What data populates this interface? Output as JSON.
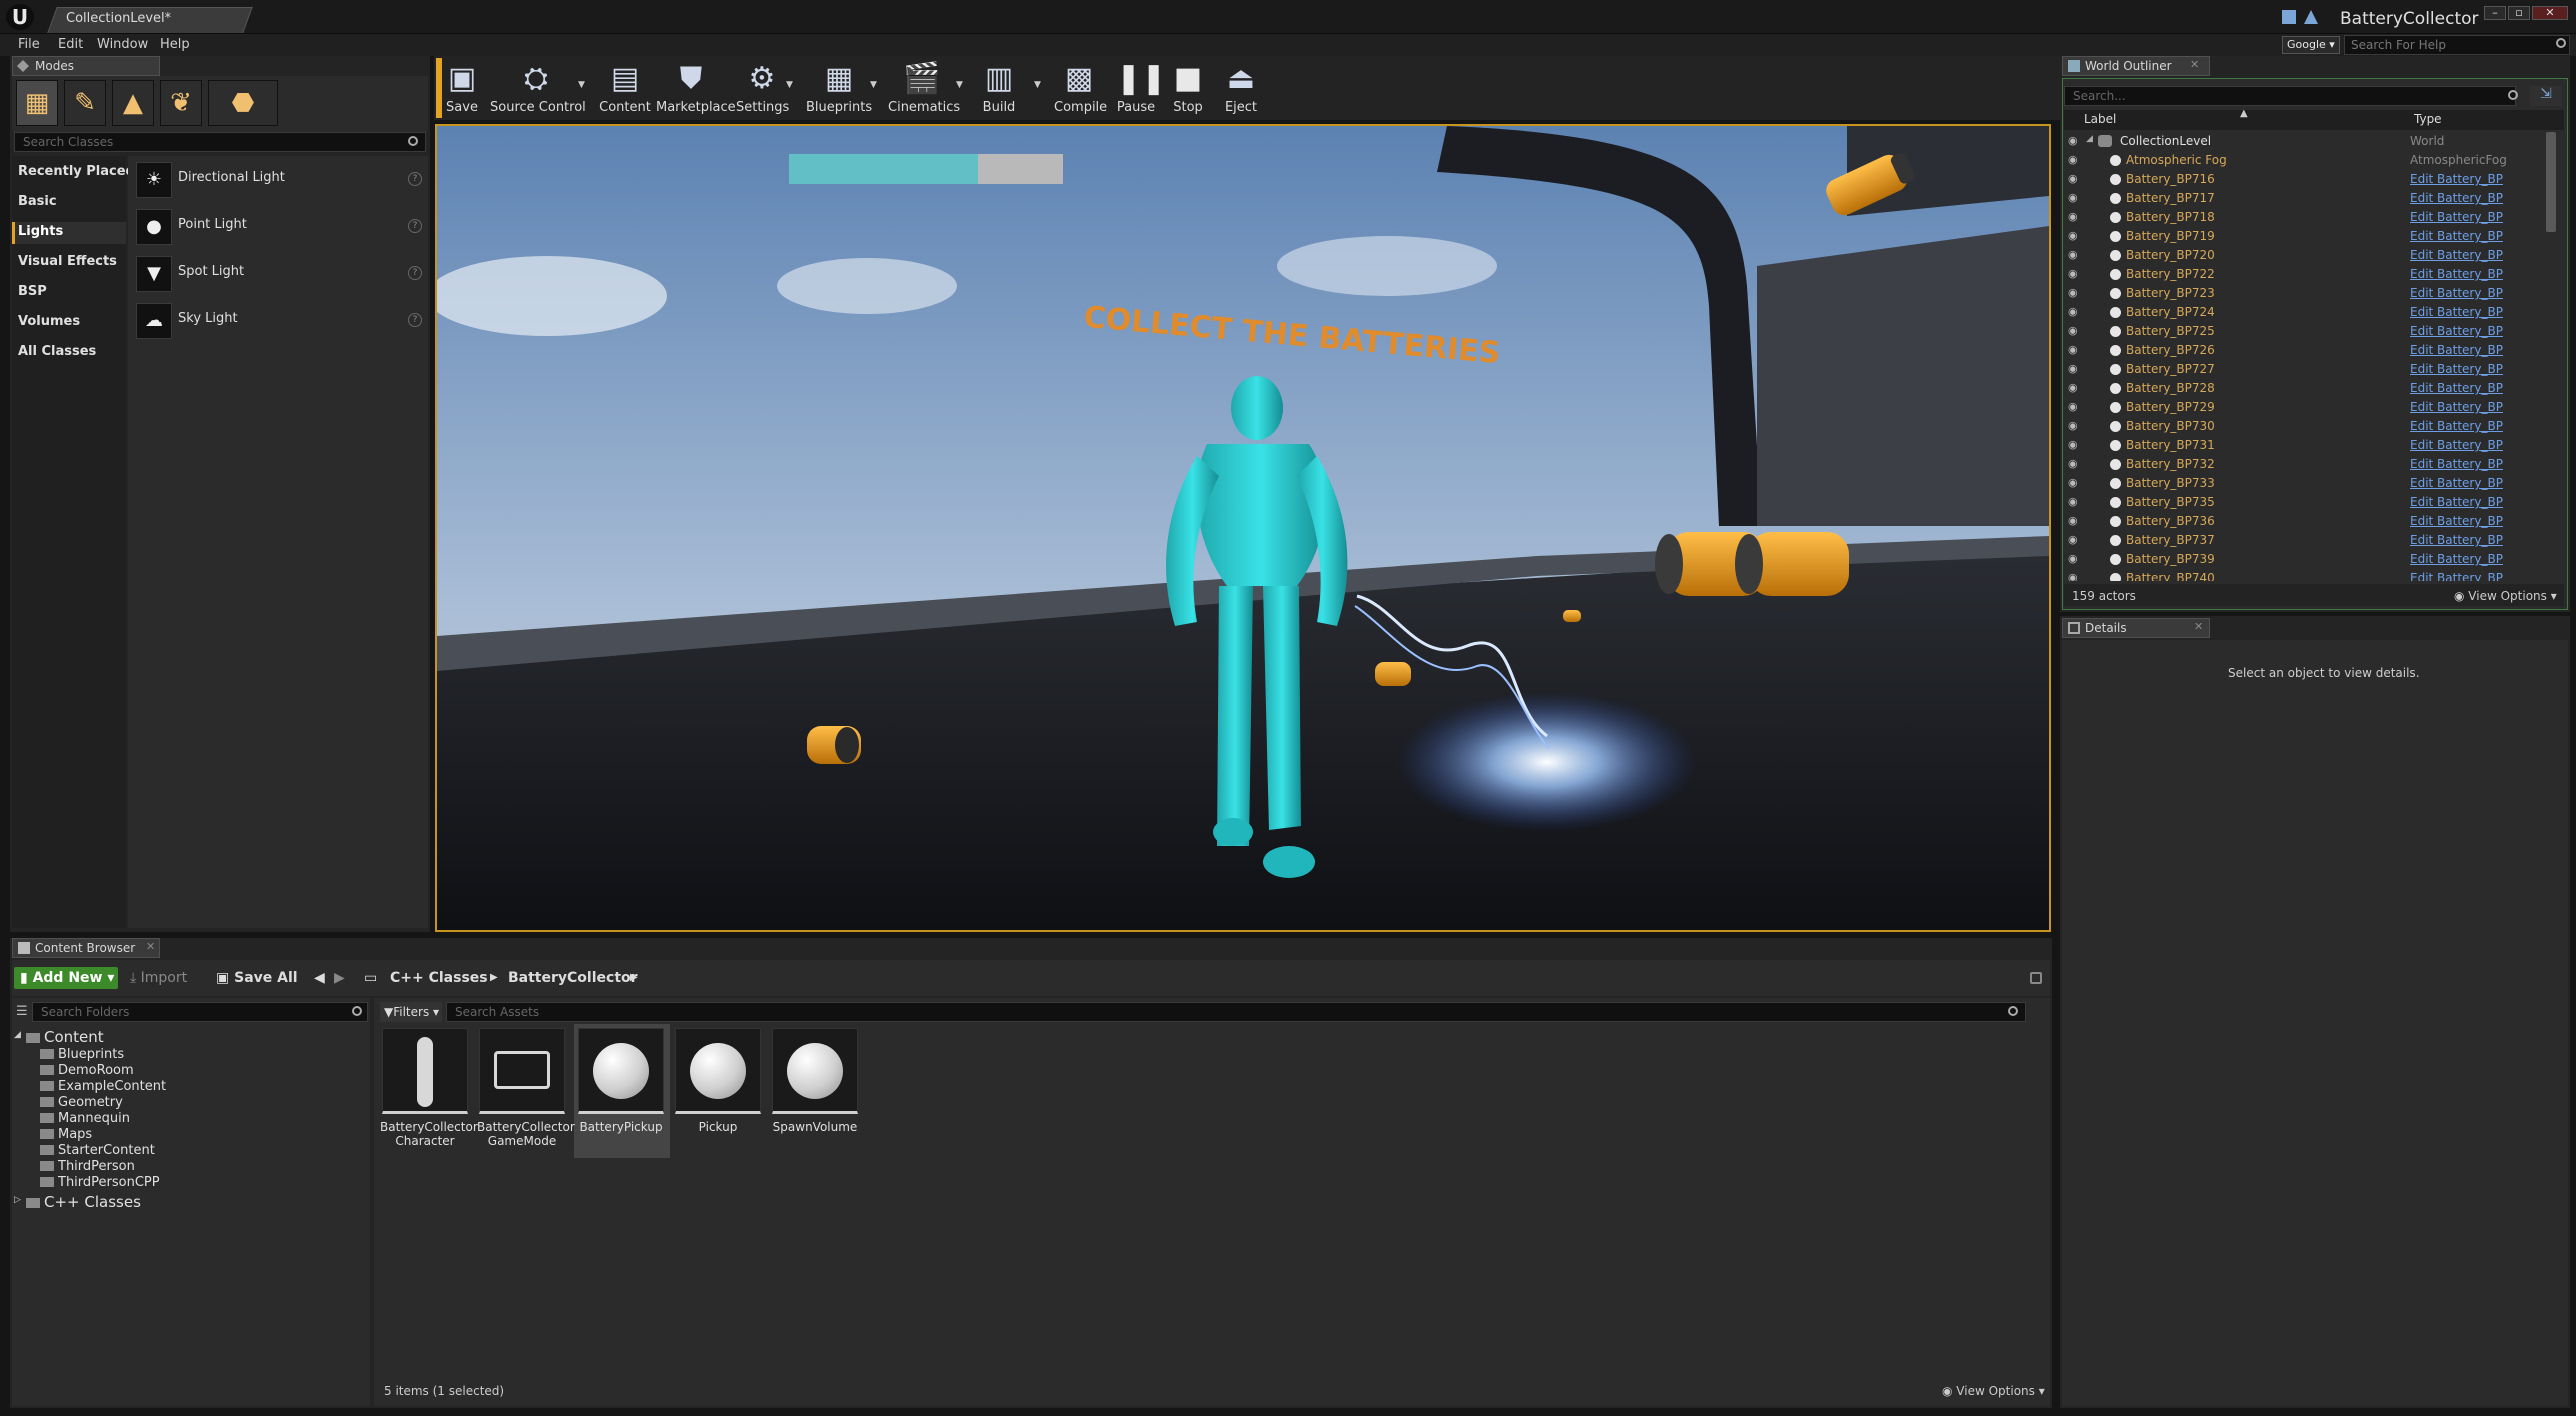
{
  "window": {
    "doc_tab": "CollectionLevel*",
    "app_name": "BatteryCollector"
  },
  "menu": [
    "File",
    "Edit",
    "Window",
    "Help"
  ],
  "help": {
    "provider": "Google",
    "search_placeholder": "Search For Help"
  },
  "modes": {
    "tab": "Modes",
    "search_placeholder": "Search Classes",
    "categories": [
      "Recently Placed",
      "Basic",
      "Lights",
      "Visual Effects",
      "BSP",
      "Volumes",
      "All Classes"
    ],
    "selected_category": "Lights",
    "items": [
      {
        "label": "Directional Light",
        "icon": "directional-light-icon"
      },
      {
        "label": "Point Light",
        "icon": "point-light-icon"
      },
      {
        "label": "Spot Light",
        "icon": "spot-light-icon"
      },
      {
        "label": "Sky Light",
        "icon": "sky-light-icon"
      }
    ]
  },
  "toolbar": [
    {
      "label": "Save",
      "icon": "save-icon"
    },
    {
      "label": "Source Control",
      "icon": "source-control-icon"
    },
    {
      "label": "Content",
      "icon": "content-icon"
    },
    {
      "label": "Marketplace",
      "icon": "marketplace-icon"
    },
    {
      "label": "Settings",
      "icon": "settings-icon"
    },
    {
      "label": "Blueprints",
      "icon": "blueprints-icon"
    },
    {
      "label": "Cinematics",
      "icon": "cinematics-icon"
    },
    {
      "label": "Build",
      "icon": "build-icon"
    },
    {
      "label": "Compile",
      "icon": "compile-icon"
    },
    {
      "label": "Pause",
      "icon": "pause-icon"
    },
    {
      "label": "Stop",
      "icon": "stop-icon"
    },
    {
      "label": "Eject",
      "icon": "eject-icon"
    }
  ],
  "viewport": {
    "hud_text": "COLLECT THE BATTERIES",
    "power_level": 0.69,
    "colors": {
      "character": "#2ad4d9",
      "battery": "#e59a1e",
      "hud_bar": "#62bfc6"
    }
  },
  "outliner": {
    "tab": "World Outliner",
    "search_placeholder": "Search...",
    "col_label": "Label",
    "col_type": "Type",
    "root": {
      "label": "CollectionLevel",
      "type": "World"
    },
    "rows": [
      {
        "label": "Atmospheric Fog",
        "type": "AtmosphericFog"
      },
      {
        "label": "Battery_BP716",
        "type": "Edit Battery_BP"
      },
      {
        "label": "Battery_BP717",
        "type": "Edit Battery_BP"
      },
      {
        "label": "Battery_BP718",
        "type": "Edit Battery_BP"
      },
      {
        "label": "Battery_BP719",
        "type": "Edit Battery_BP"
      },
      {
        "label": "Battery_BP720",
        "type": "Edit Battery_BP"
      },
      {
        "label": "Battery_BP722",
        "type": "Edit Battery_BP"
      },
      {
        "label": "Battery_BP723",
        "type": "Edit Battery_BP"
      },
      {
        "label": "Battery_BP724",
        "type": "Edit Battery_BP"
      },
      {
        "label": "Battery_BP725",
        "type": "Edit Battery_BP"
      },
      {
        "label": "Battery_BP726",
        "type": "Edit Battery_BP"
      },
      {
        "label": "Battery_BP727",
        "type": "Edit Battery_BP"
      },
      {
        "label": "Battery_BP728",
        "type": "Edit Battery_BP"
      },
      {
        "label": "Battery_BP729",
        "type": "Edit Battery_BP"
      },
      {
        "label": "Battery_BP730",
        "type": "Edit Battery_BP"
      },
      {
        "label": "Battery_BP731",
        "type": "Edit Battery_BP"
      },
      {
        "label": "Battery_BP732",
        "type": "Edit Battery_BP"
      },
      {
        "label": "Battery_BP733",
        "type": "Edit Battery_BP"
      },
      {
        "label": "Battery_BP735",
        "type": "Edit Battery_BP"
      },
      {
        "label": "Battery_BP736",
        "type": "Edit Battery_BP"
      },
      {
        "label": "Battery_BP737",
        "type": "Edit Battery_BP"
      },
      {
        "label": "Battery_BP739",
        "type": "Edit Battery_BP"
      },
      {
        "label": "Battery_BP740",
        "type": "Edit Battery_BP"
      }
    ],
    "actor_count": "159 actors",
    "view_options": "View Options"
  },
  "details": {
    "tab": "Details",
    "empty_text": "Select an object to view details."
  },
  "content_browser": {
    "tab": "Content Browser",
    "add_new": "Add New",
    "import": "Import",
    "save_all": "Save All",
    "path": [
      "C++ Classes",
      "BatteryCollector"
    ],
    "folder_search_placeholder": "Search Folders",
    "filters": "Filters",
    "asset_search_placeholder": "Search Assets",
    "folders": {
      "root": "Content",
      "children": [
        "Blueprints",
        "DemoRoom",
        "ExampleContent",
        "Geometry",
        "Mannequin",
        "Maps",
        "StarterContent",
        "ThirdPerson",
        "ThirdPersonCPP"
      ],
      "cpp_root": "C++ Classes"
    },
    "assets": [
      {
        "label": "BatteryCollector Character",
        "thumb": "character-icon"
      },
      {
        "label": "BatteryCollector GameMode",
        "thumb": "gamemode-icon"
      },
      {
        "label": "BatteryPickup",
        "thumb": "sphere-icon"
      },
      {
        "label": "Pickup",
        "thumb": "sphere-icon"
      },
      {
        "label": "SpawnVolume",
        "thumb": "sphere-icon"
      }
    ],
    "status": "5 items (1 selected)",
    "view_options": "View Options"
  }
}
